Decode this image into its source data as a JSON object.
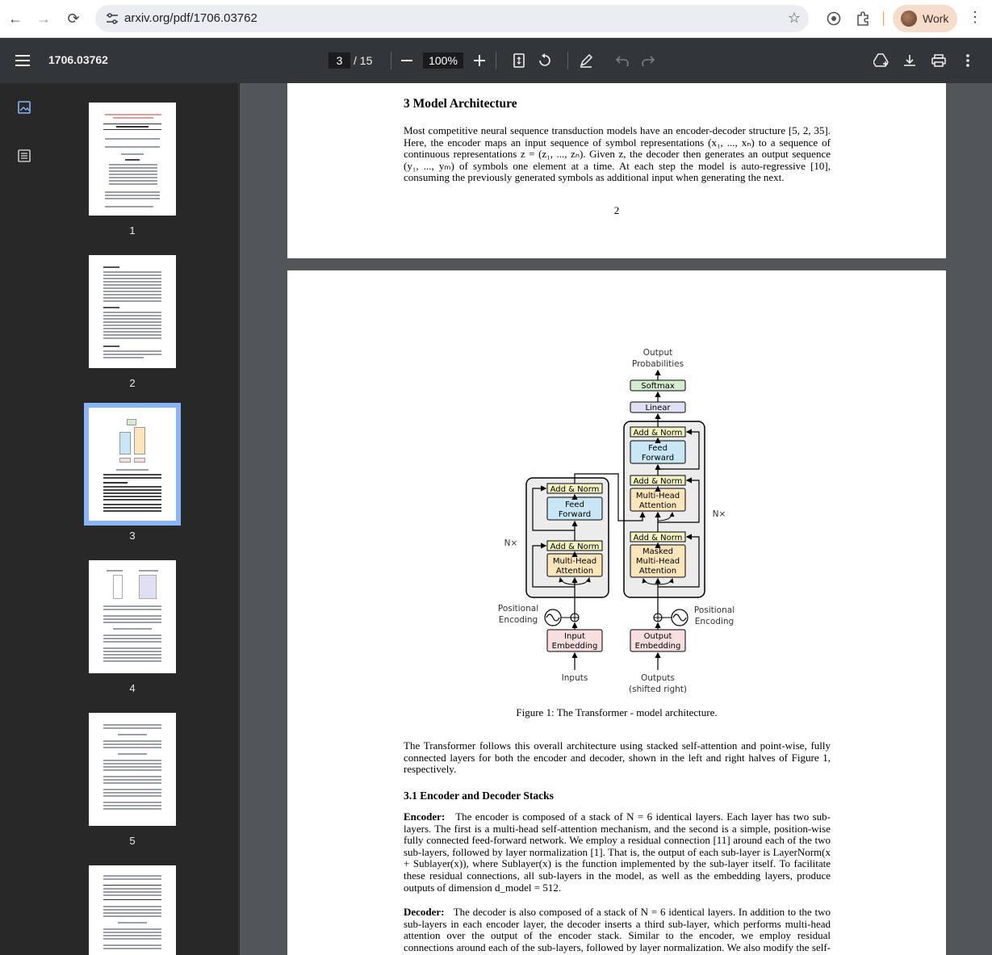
{
  "browser": {
    "url": "arxiv.org/pdf/1706.03762",
    "profile_name": "Work"
  },
  "toolbar": {
    "doc_title": "1706.03762",
    "current_page": "3",
    "total_pages": "/ 15",
    "zoom": "100%"
  },
  "sidebar": {
    "thumbnails": [
      {
        "label": "1"
      },
      {
        "label": "2"
      },
      {
        "label": "3",
        "active": true
      },
      {
        "label": "4"
      },
      {
        "label": "5"
      }
    ]
  },
  "page2": {
    "section_heading": "3   Model Architecture",
    "paragraph": "Most competitive neural sequence transduction models have an encoder-decoder structure [5, 2, 35]. Here, the encoder maps an input sequence of symbol representations (x₁, ..., xₙ) to a sequence of continuous representations z = (z₁, ..., zₙ). Given z, the decoder then generates an output sequence (y₁, ..., yₘ) of symbols one element at a time. At each step the model is auto-regressive [10], consuming the previously generated symbols as additional input when generating the next.",
    "page_number": "2"
  },
  "figure": {
    "output_probabilities_1": "Output",
    "output_probabilities_2": "Probabilities",
    "softmax": "Softmax",
    "linear": "Linear",
    "add_norm": "Add & Norm",
    "feed": "Feed",
    "forward": "Forward",
    "multi_head": "Multi-Head",
    "attention": "Attention",
    "masked": "Masked",
    "nx": "N×",
    "positional": "Positional",
    "encoding": "Encoding",
    "input": "Input",
    "output": "Output",
    "embedding": "Embedding",
    "inputs": "Inputs",
    "outputs": "Outputs",
    "shifted_right": "(shifted right)",
    "caption": "Figure 1: The Transformer - model architecture."
  },
  "page3": {
    "intro": "The Transformer follows this overall architecture using stacked self-attention and point-wise, fully connected layers for both the encoder and decoder, shown in the left and right halves of Figure 1, respectively.",
    "subsection_heading": "3.1   Encoder and Decoder Stacks",
    "encoder_label": "Encoder:",
    "encoder_text": "The encoder is composed of a stack of N = 6 identical layers. Each layer has two sub-layers. The first is a multi-head self-attention mechanism, and the second is a simple, position-wise fully connected feed-forward network. We employ a residual connection [11] around each of the two sub-layers, followed by layer normalization [1]. That is, the output of each sub-layer is LayerNorm(x + Sublayer(x)), where Sublayer(x) is the function implemented by the sub-layer itself. To facilitate these residual connections, all sub-layers in the model, as well as the embedding layers, produce outputs of dimension d_model = 512.",
    "decoder_label": "Decoder:",
    "decoder_text": "The decoder is also composed of a stack of N = 6 identical layers. In addition to the two sub-layers in each encoder layer, the decoder inserts a third sub-layer, which performs multi-head attention over the output of the encoder stack. Similar to the encoder, we employ residual connections around each of the sub-layers, followed by layer normalization. We also modify the self-attention"
  },
  "colors": {
    "toolbar_bg": "#323639",
    "viewer_bg": "#525659",
    "active_thumb": "#8ab4f8",
    "softmax_fill": "#d5ecd1",
    "linear_fill": "#dfe0f3",
    "addnorm_fill": "#f4f3c2",
    "ff_fill": "#c8e6f6",
    "attn_fill": "#fce4bb",
    "embed_fill": "#f8dedf"
  }
}
